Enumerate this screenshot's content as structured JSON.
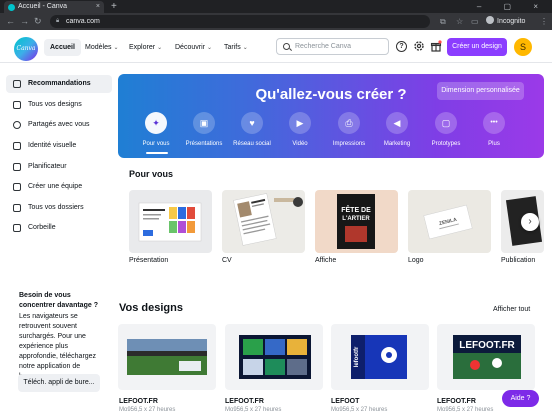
{
  "browser": {
    "tab_title": "Accueil - Canva",
    "tab_close": "×",
    "new_tab": "+",
    "window_controls": "– ▢ ×",
    "url": "canva.com",
    "incognito_label": "Incognito",
    "back_icon": "arrow-left",
    "forward_icon": "arrow-right",
    "reload_icon": "reload"
  },
  "header": {
    "logo_text": "Canva",
    "nav": [
      {
        "label": "Accueil",
        "active": true
      },
      {
        "label": "Modèles",
        "has_caret": true
      },
      {
        "label": "Explorer",
        "has_caret": true
      },
      {
        "label": "Découvrir",
        "has_caret": true
      },
      {
        "label": "Tarifs",
        "has_caret": true
      }
    ],
    "caret": "⌄",
    "search_placeholder": "Recherche Canva",
    "help_glyph": "?",
    "create_button": "Créer un design",
    "avatar_initial": "S",
    "colors": {
      "accent": "#8b3dff",
      "avatar": "#ffb800"
    }
  },
  "sidebar": {
    "items": [
      {
        "label": "Recommandations",
        "active": true
      },
      {
        "label": "Tous vos designs"
      },
      {
        "label": "Partagés avec vous"
      },
      {
        "label": "Identité visuelle"
      },
      {
        "label": "Planificateur"
      },
      {
        "label": "Créer une équipe"
      },
      {
        "label": "Tous vos dossiers"
      },
      {
        "label": "Corbeille"
      }
    ],
    "tip": {
      "title": "Besoin de vous concentrer davantage ?",
      "body": "Les navigateurs se retrouvent souvent surchargés. Pour une expérience plus approfondie, téléchargez notre application de bureau.",
      "button": "Téléch. appli de bure..."
    }
  },
  "hero": {
    "title": "Qu'allez-vous créer ?",
    "custom_size_button": "Dimension personnalisée",
    "categories": [
      {
        "label": "Pour vous",
        "icon": "sparkle-icon",
        "glyph": "✦",
        "active": true
      },
      {
        "label": "Présentations",
        "icon": "presentation-icon",
        "glyph": "▣"
      },
      {
        "label": "Réseau social",
        "icon": "heart-icon",
        "glyph": "♥"
      },
      {
        "label": "Vidéo",
        "icon": "video-icon",
        "glyph": "▶"
      },
      {
        "label": "Impressions",
        "icon": "printer-icon",
        "glyph": "⎙"
      },
      {
        "label": "Marketing",
        "icon": "megaphone-icon",
        "glyph": "◀"
      },
      {
        "label": "Prototypes",
        "icon": "cursor-icon",
        "glyph": "▢"
      },
      {
        "label": "Plus",
        "icon": "more-icon",
        "glyph": "•••"
      }
    ],
    "colors": {
      "start": "#1f7fd4",
      "end": "#9b3ae8"
    }
  },
  "pour_vous": {
    "title": "Pour vous",
    "items": [
      {
        "label": "Présentation"
      },
      {
        "label": "CV"
      },
      {
        "label": "Affiche",
        "thumb_text": "FÊTE DE\nL'ARTIER"
      },
      {
        "label": "Logo",
        "thumb_text": "ZENILA"
      },
      {
        "label": "Publication"
      }
    ],
    "next_glyph": "›"
  },
  "designs": {
    "title": "Vos designs",
    "show_all": "Afficher tout",
    "items": [
      {
        "name": "LEFOOT.FR",
        "size": "Mo956,5 x 27 heures"
      },
      {
        "name": "LEFOOT.FR",
        "size": "Mo956,5 x 27 heures"
      },
      {
        "name": "LEFOOT",
        "size": "Mo956,5 x 27 heures",
        "thumb_text": "lefootfr"
      },
      {
        "name": "LEFOOT.FR",
        "size": "Mo956,5 x 27 heures",
        "thumb_text": "LEFOOT.FR"
      }
    ]
  },
  "help_button": "Aide ?"
}
